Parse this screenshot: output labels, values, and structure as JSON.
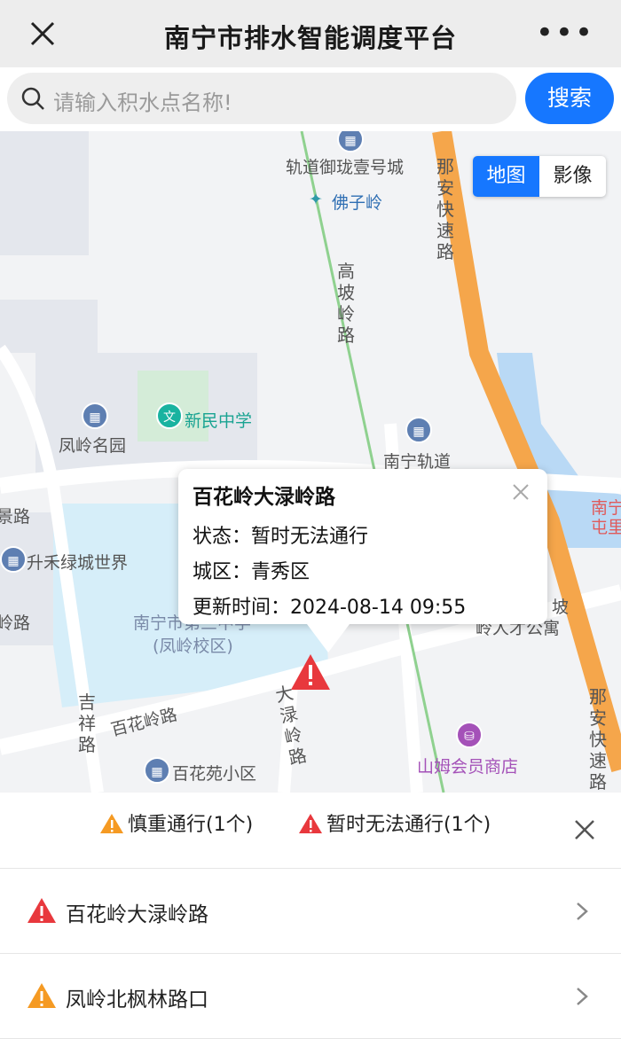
{
  "header": {
    "title": "南宁市排水智能调度平台",
    "more_label": "•••"
  },
  "search": {
    "placeholder": "请输入积水点名称!",
    "button_label": "搜索"
  },
  "map": {
    "toggle": {
      "map_label": "地图",
      "image_label": "影像",
      "selected": "地图"
    },
    "labels": {
      "poi_1": "轨道御珑壹号城",
      "poi_2": "佛子岭",
      "road_1": "高坡岭路",
      "road_2": "那安快速路",
      "poi_3": "凤岭名园",
      "poi_4": "新民中学",
      "poi_5": "南宁轨道",
      "road_3": "景路",
      "poi_6": "升禾绿城世界",
      "road_4": "岭路",
      "poi_7": "南宁市第三中学",
      "poi_8": "(凤岭校区)",
      "road_5": "吉祥路",
      "road_6": "百花岭路",
      "road_7": "大渌岭路",
      "poi_9": "百花苑小区",
      "poi_10": "山姆会员商店",
      "poi_11": "南宁屯里",
      "poi_12": "坡",
      "poi_13": "岭人才公寓",
      "road_8": "那安快速路"
    },
    "popup": {
      "title": "百花岭大渌岭路",
      "status": "状态：暂时无法通行",
      "district": "城区：青秀区",
      "updated": "更新时间：2024-08-14 09:55"
    },
    "colors": {
      "expressway": "#f5a64b",
      "rail": "#8fd18f",
      "water": "#b9d9f5",
      "search": "#1677ff",
      "warn_red": "#e8383d",
      "warn_orange": "#f59a23"
    }
  },
  "legend": {
    "caution_label": "慎重通行(1个)",
    "blocked_label": "暂时无法通行(1个)"
  },
  "list": [
    {
      "name": "百花岭大渌岭路",
      "severity": "red"
    },
    {
      "name": "凤岭北枫林路口",
      "severity": "orange"
    }
  ]
}
